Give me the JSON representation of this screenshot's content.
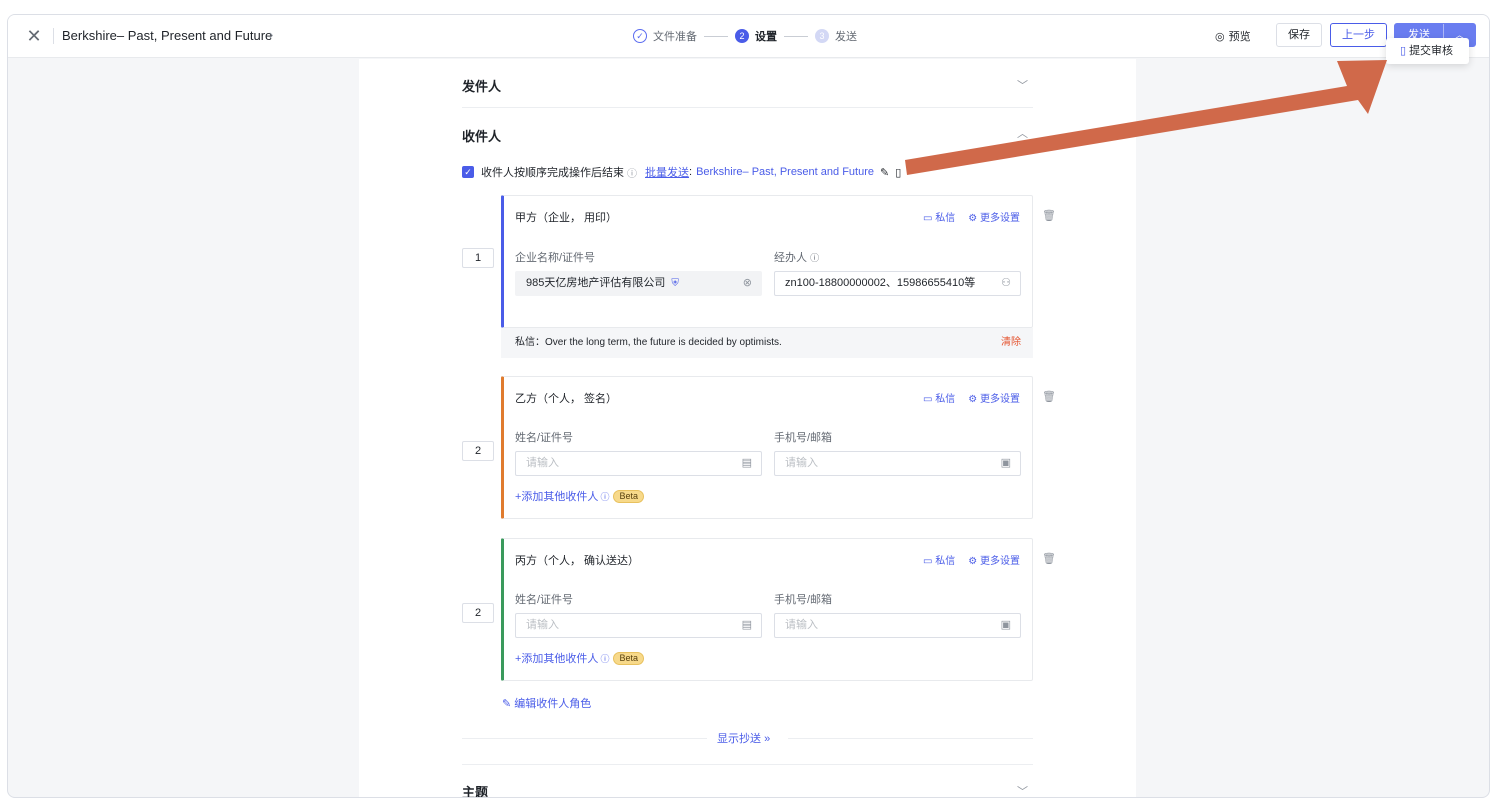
{
  "header": {
    "title": "Berkshire– Past, Present and Future",
    "steps": [
      {
        "num": "✓",
        "label": "文件准备"
      },
      {
        "num": "2",
        "label": "设置"
      },
      {
        "num": "3",
        "label": "发送"
      }
    ],
    "preview_label": "预览",
    "save_label": "保存",
    "prev_label": "上一步",
    "send_label": "发送",
    "dropdown_item": "提交审核"
  },
  "sender": {
    "title": "发件人"
  },
  "recipients": {
    "title": "收件人",
    "sequential_label": "收件人按顺序完成操作后结束",
    "batch_link": "批量发送",
    "batch_colon": ":",
    "batch_value": "Berkshire– Past, Present and Future",
    "cards": [
      {
        "order": "1",
        "head": "甲方（企业，  用印）",
        "private_label": "私信",
        "more_label": "更多设置",
        "field1_label": "企业名称/证件号",
        "field1_value": "985天亿房地产评估有限公司",
        "field2_label": "经办人",
        "field2_value": "zn100-18800000002、15986655410等",
        "note": "私信：Over the long term, the future is decided by optimists.",
        "note_clear": "清除"
      },
      {
        "order": "2",
        "head": "乙方（个人，  签名）",
        "private_label": "私信",
        "more_label": "更多设置",
        "field1_label": "姓名/证件号",
        "field1_placeholder": "请输入",
        "field2_label": "手机号/邮箱",
        "field2_placeholder": "请输入",
        "add_more": "+添加其他收件人",
        "beta": "Beta"
      },
      {
        "order": "2",
        "head": "丙方（个人，  确认送达）",
        "private_label": "私信",
        "more_label": "更多设置",
        "field1_label": "姓名/证件号",
        "field1_placeholder": "请输入",
        "field2_label": "手机号/邮箱",
        "field2_placeholder": "请输入",
        "add_more": "+添加其他收件人",
        "beta": "Beta"
      }
    ],
    "edit_roles": "编辑收件人角色",
    "show_cc": "显示抄送"
  },
  "subject": {
    "title": "主题"
  },
  "colors": {
    "accent": "#4a5ce8",
    "card1": "#4a5ce8",
    "card2": "#e07b2e",
    "card3": "#3a9a5c",
    "arrow": "#d0694a"
  }
}
